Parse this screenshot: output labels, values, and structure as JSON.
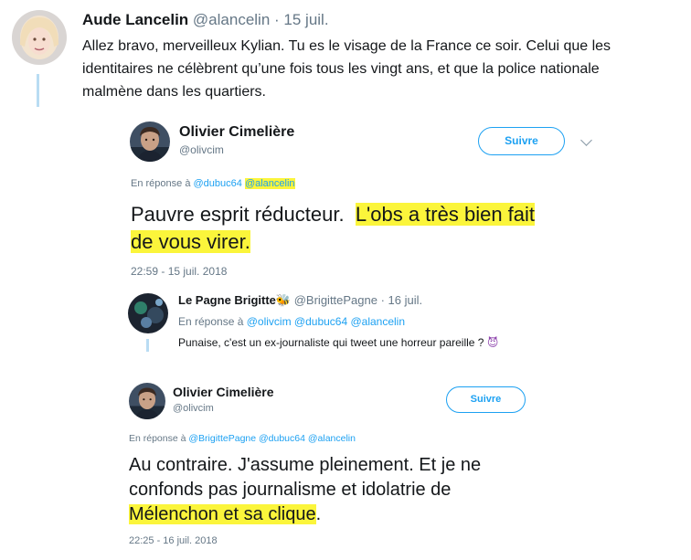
{
  "tweet1": {
    "name": "Aude Lancelin",
    "handle": "@alancelin",
    "date": "· 15 juil.",
    "text_lines": [
      "Allez bravo, merveilleux Kylian. Tu es le visage de la France ce soir. Celui que les",
      "identitaires ne célèbrent qu’une fois tous les vingt ans, et que la police nationale",
      "malmène dans les quartiers."
    ]
  },
  "tweet2": {
    "name": "Olivier Cimelière",
    "handle": "@olivcim",
    "follow_label": "Suivre",
    "reply_prefix": "En réponse à",
    "reply_mention_1": "@dubuc64",
    "reply_mention_2": "@alancelin",
    "text_plain": "Pauvre esprit réducteur.",
    "text_hl_1": "L'obs a très bien fait",
    "text_hl_2": "de vous virer.",
    "timestamp": "22:59 - 15 juil. 2018"
  },
  "tweet3": {
    "name": "Le Pagne Brigitte",
    "emoji": "🐝",
    "handle": "@BrigittePagne",
    "date": "· 16 juil.",
    "reply_prefix": "En réponse à",
    "reply_mentions": "@olivcim @dubuc64 @alancelin",
    "text": "Punaise, c'est un ex-journaliste qui tweet une horreur pareille ?",
    "text_emoji": "😈"
  },
  "tweet4": {
    "name": "Olivier Cimelière",
    "handle": "@olivcim",
    "follow_label": "Suivre",
    "reply_prefix": "En réponse à",
    "reply_mentions": "@BrigittePagne @dubuc64 @alancelin",
    "text_line_1": "Au contraire. J'assume pleinement. Et je ne",
    "text_line_2": "confonds pas journalisme et idolatrie de",
    "text_hl": "Mélenchon et sa clique",
    "text_end": ".",
    "timestamp": "22:25 - 16 juil. 2018"
  },
  "colors": {
    "accent": "#1da1f2",
    "highlight": "#fbf53b",
    "muted": "#657786",
    "thread": "#b9dcf3"
  }
}
